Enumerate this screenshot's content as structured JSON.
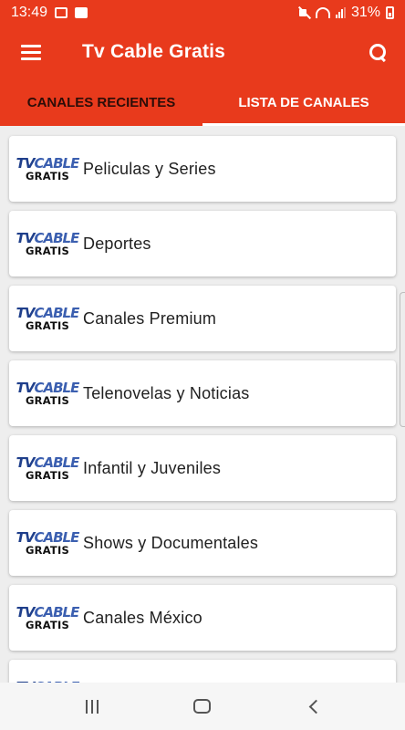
{
  "status_bar": {
    "time": "13:49",
    "battery_percent": "31%"
  },
  "app_bar": {
    "title": "Tv Cable Gratis"
  },
  "tabs": [
    {
      "label": "CANALES RECIENTES",
      "selected": false
    },
    {
      "label": "LISTA DE CANALES",
      "selected": true
    }
  ],
  "logo": {
    "line1_left": "TV",
    "line1_right": "CABLE",
    "line2": "GRATIS"
  },
  "categories": [
    {
      "label": "Peliculas y Series"
    },
    {
      "label": "Deportes"
    },
    {
      "label": "Canales Premium"
    },
    {
      "label": "Telenovelas y Noticias"
    },
    {
      "label": "Infantil y Juveniles"
    },
    {
      "label": "Shows y Documentales"
    },
    {
      "label": "Canales México"
    },
    {
      "label": ""
    }
  ],
  "colors": {
    "primary": "#e83a1c",
    "tab_selected_text": "#ffffff",
    "tab_unselected_text": "#2c0d08",
    "background": "#eeeeee"
  },
  "icons": {
    "menu": "hamburger-icon",
    "search": "search-icon",
    "nav_recents": "recents-icon",
    "nav_home": "home-icon",
    "nav_back": "back-icon"
  }
}
